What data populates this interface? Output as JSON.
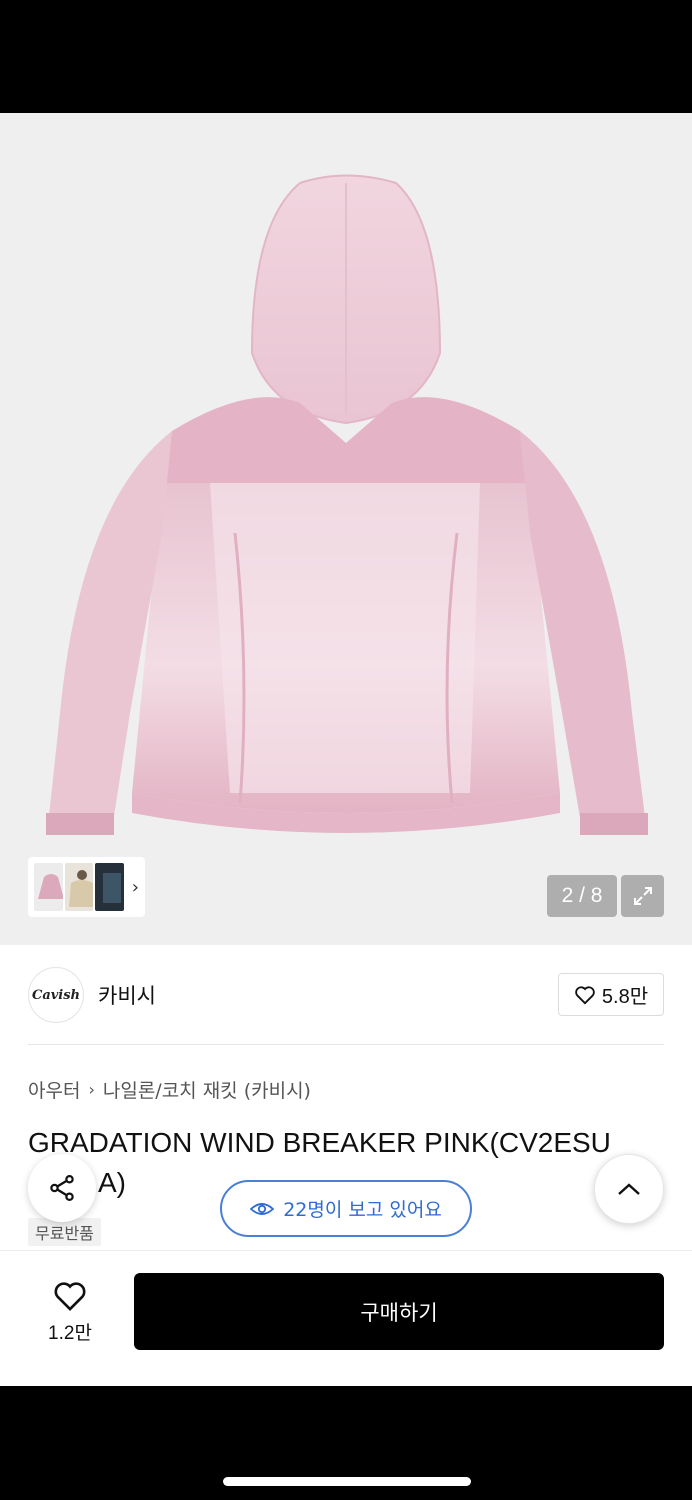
{
  "gallery": {
    "counter": "2 / 8",
    "thumbnails": [
      "pink-jacket-thumb",
      "beige-jacket-thumb",
      "dark-jacket-thumb"
    ]
  },
  "brand": {
    "logo_text": "Cavish",
    "name": "카비시",
    "like_count": "5.8만"
  },
  "breadcrumb": {
    "category": "아우터",
    "subcategory": "나일론/코치 재킷 (카비시)"
  },
  "product": {
    "title": "GRADATION WIND BREAKER PINK(CV2ESU",
    "title_line2_visible": "A)",
    "badge": "무료반품"
  },
  "viewers": {
    "text": "22명이 보고 있어요"
  },
  "bottom_bar": {
    "wish_count": "1.2만",
    "buy_label": "구매하기"
  },
  "colors": {
    "accent_blue": "#2f6bd1",
    "jacket_pink": "#e8b9cb"
  },
  "icons": [
    "heart-icon",
    "share-icon",
    "chevron-up-icon",
    "eye-icon",
    "expand-icon",
    "chevron-right-icon"
  ]
}
